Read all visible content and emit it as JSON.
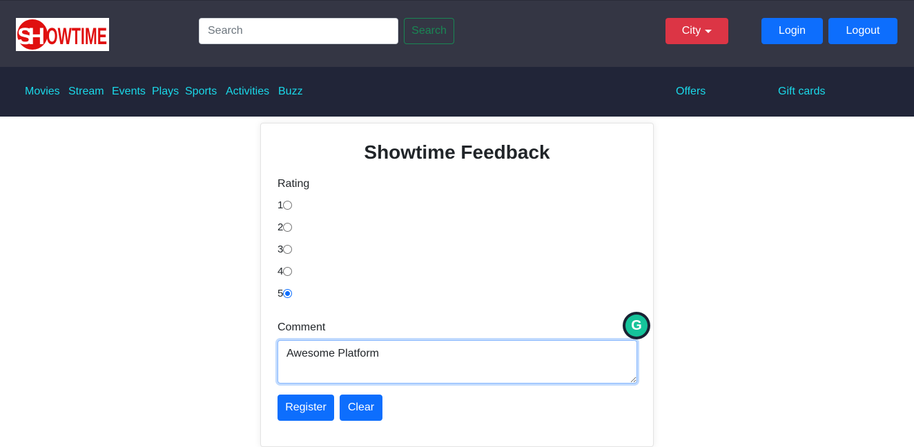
{
  "header": {
    "logo_text": "SHOWTIME",
    "search": {
      "placeholder": "Search",
      "value": "",
      "button_label": "Search"
    },
    "city_label": "City",
    "login_label": "Login",
    "logout_label": "Logout"
  },
  "nav": {
    "items": [
      "Movies",
      "Stream",
      "Events",
      "Plays",
      "Sports",
      "Activities",
      "Buzz"
    ],
    "right_items": [
      "Offers",
      "Gift cards"
    ]
  },
  "form": {
    "title": "Showtime Feedback",
    "rating_label": "Rating",
    "ratings": [
      "1",
      "2",
      "3",
      "4",
      "5"
    ],
    "selected_rating": "5",
    "comment_label": "Comment",
    "comment_value": "Awesome Platform",
    "register_label": "Register",
    "clear_label": "Clear"
  },
  "colors": {
    "topbar": "#343644",
    "navbar": "#212538",
    "nav_link": "#1ad8e8",
    "primary": "#0d6efd",
    "danger": "#dc3545",
    "success": "#198754",
    "logo_red": "#e01010"
  },
  "icons": {
    "city_caret": "caret-down-icon",
    "grammarly": "grammarly-icon"
  }
}
